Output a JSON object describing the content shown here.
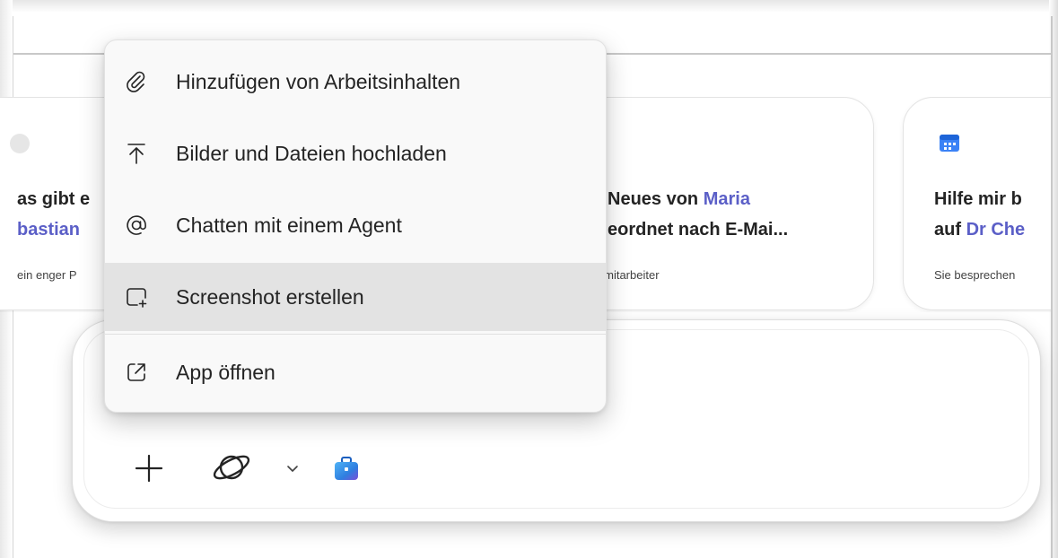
{
  "cards": [
    {
      "title_line1": "as gibt e",
      "title_line2_highlight": "bastian",
      "subtitle": "ein enger P"
    },
    {
      "title_line1_prefix": "Neues von ",
      "title_line1_highlight": "Maria",
      "title_line2": "eordnet nach E-Mai...",
      "subtitle": "ktmitarbeiter"
    },
    {
      "icon": "calendar-icon",
      "title_line1": "Hilfe mir b",
      "title_line2_prefix": "auf ",
      "title_line2_highlight": "Dr Che",
      "subtitle": "Sie besprechen"
    }
  ],
  "menu": {
    "items": [
      {
        "label": "Hinzufügen von Arbeitsinhalten",
        "icon": "paperclip-icon"
      },
      {
        "label": "Bilder und Dateien hochladen",
        "icon": "upload-icon"
      },
      {
        "label": "Chatten mit einem Agent",
        "icon": "at-sign-icon"
      },
      {
        "label": "Screenshot erstellen",
        "icon": "screenshot-icon",
        "highlighted": true
      },
      {
        "label": "App öffnen",
        "icon": "open-external-icon"
      }
    ]
  },
  "compose": {
    "tools": [
      {
        "name": "add",
        "icon": "plus-icon"
      },
      {
        "name": "model",
        "icon": "model-switcher-icon"
      },
      {
        "name": "model-dropdown",
        "icon": "chevron-down-icon"
      },
      {
        "name": "work",
        "icon": "briefcase-icon"
      }
    ]
  },
  "colors": {
    "accent": "#5b5fc7",
    "menu_background": "#f9f9f9",
    "menu_highlight": "#e3e3e3",
    "text": "#242424"
  }
}
